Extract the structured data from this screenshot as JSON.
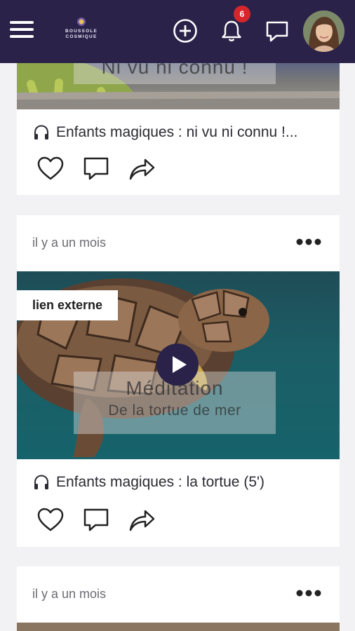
{
  "header": {
    "logo_line1": "BOUSSOLE",
    "logo_line2": "COSMIQUE",
    "notification_count": "6",
    "icons": [
      "menu-icon",
      "add-icon",
      "bell-icon",
      "chat-icon"
    ],
    "colors": {
      "header_bg": "#2a2249",
      "badge": "#d6262c"
    }
  },
  "posts": [
    {
      "overlay_title": "Ni vu ni connu !",
      "caption": "Enfants magiques : ni vu ni connu !...",
      "caption_icon": "headphones-icon"
    },
    {
      "timestamp": "il y a un mois",
      "tag": "lien externe",
      "overlay_title": "Méditation",
      "overlay_subtitle": "De la tortue de mer",
      "caption": "Enfants magiques : la tortue (5')",
      "caption_icon": "headphones-icon"
    },
    {
      "timestamp": "il y a un mois"
    }
  ]
}
